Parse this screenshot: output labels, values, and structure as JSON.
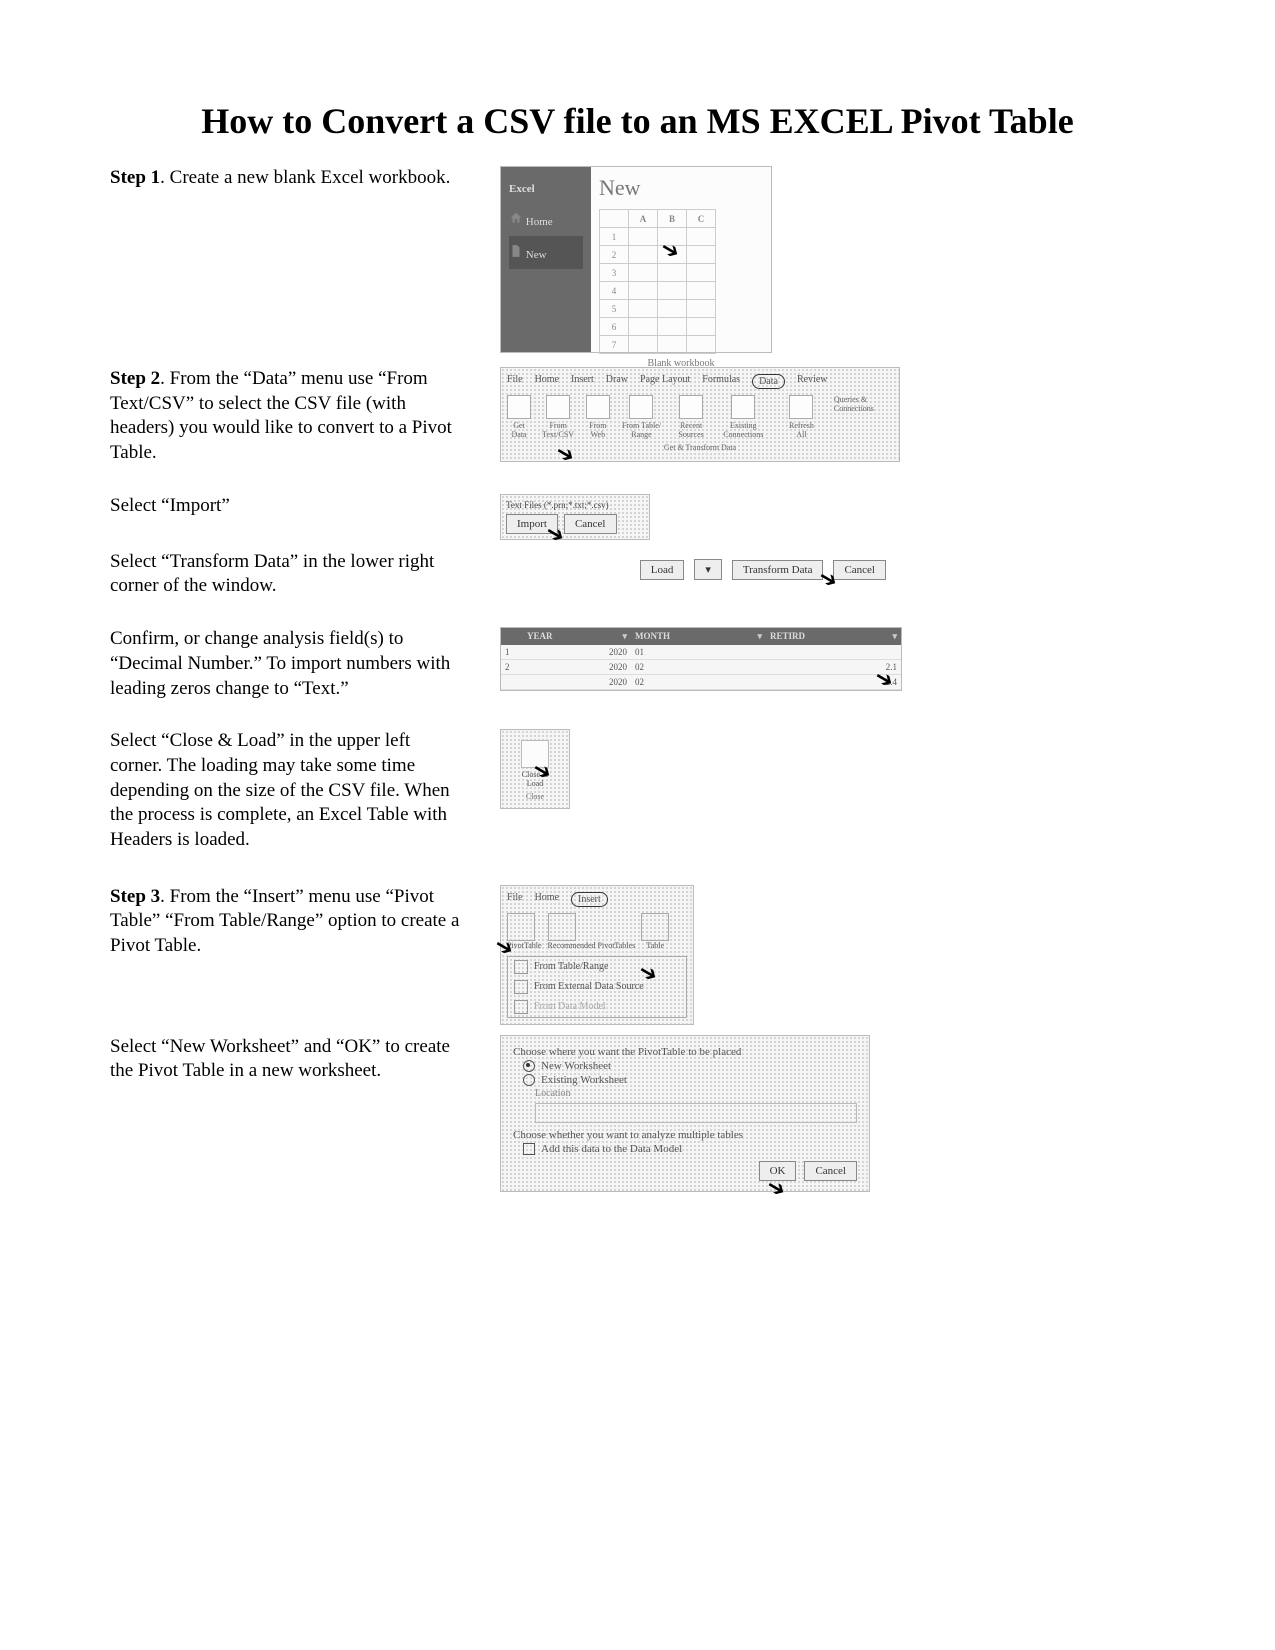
{
  "title": "How to Convert a CSV file to an MS EXCEL Pivot Table",
  "step1": {
    "label": "Step 1",
    "text": ". Create a new blank Excel workbook.",
    "excel": {
      "app": "Excel",
      "home": "Home",
      "new_nav": "New",
      "new_title": "New",
      "cols": [
        "A",
        "B",
        "C"
      ],
      "rows": [
        "1",
        "2",
        "3",
        "4",
        "5",
        "6",
        "7"
      ],
      "caption": "Blank workbook"
    }
  },
  "step2": {
    "label": "Step 2",
    "text": ". From the “Data” menu use “From Text/CSV” to select the CSV file (with headers) you would like to convert to a Pivot Table.",
    "ribbon": {
      "tabs": [
        "File",
        "Home",
        "Insert",
        "Draw",
        "Page Layout",
        "Formulas",
        "Data",
        "Review"
      ],
      "circled_tab_index": 6,
      "items": [
        "Get Data",
        "From Text/CSV",
        "From Web",
        "From Table/ Range",
        "Recent Sources",
        "Existing Connections"
      ],
      "group_label": "Get & Transform Data",
      "right_items": [
        "Refresh All"
      ],
      "right_sub": "Queries & Connections"
    },
    "p2": "Select “Import”",
    "import_dialog": {
      "title": "Text Files (*.prn;*.txt;*.csv)",
      "import_btn": "Import",
      "cancel_btn": "Cancel"
    },
    "p3": "Select “Transform Data” in the lower right corner of the window.",
    "load_buttons": {
      "load": "Load",
      "drop": "▾",
      "transform": "Transform Data",
      "cancel": "Cancel"
    },
    "p4": "Confirm, or change analysis field(s) to “Decimal Number.” To import numbers with leading zeros change to “Text.”",
    "query_table": {
      "cols": [
        "YEAR",
        "MONTH",
        "RETIRD"
      ],
      "rows": [
        [
          "1",
          "2020",
          "01",
          ""
        ],
        [
          "2",
          "2020",
          "02",
          "2.1"
        ],
        [
          "",
          "2020",
          "02",
          "2.4"
        ]
      ]
    },
    "p5": "Select “Close & Load” in the upper left corner. The loading may take some time depending on the size of the CSV file. When the process is complete, an Excel Table with Headers is loaded.",
    "close_load": {
      "label1": "Close &",
      "label2": "Load",
      "group": "Close"
    }
  },
  "step3": {
    "label": "Step 3",
    "text": ". From the “Insert” menu use “Pivot Table” “From Table/Range” option to create a Pivot Table.",
    "ribbon": {
      "tabs": [
        "File",
        "Home",
        "Insert"
      ],
      "circled_tab_index": 2,
      "items": [
        "PivotTable",
        "Recommended PivotTables",
        "Table"
      ],
      "menu": [
        "From Table/Range",
        "From External Data Source",
        "From Data Model"
      ]
    },
    "p2": "Select “New Worksheet” and “OK” to create the Pivot Table in a new worksheet.",
    "dialog": {
      "q1": "Choose where you want the PivotTable to be placed",
      "opt1": "New Worksheet",
      "opt2": "Existing Worksheet",
      "loc_label": "Location",
      "q2": "Choose whether you want to analyze multiple tables",
      "chk": "Add this data to the Data Model",
      "ok": "OK",
      "cancel": "Cancel"
    }
  }
}
